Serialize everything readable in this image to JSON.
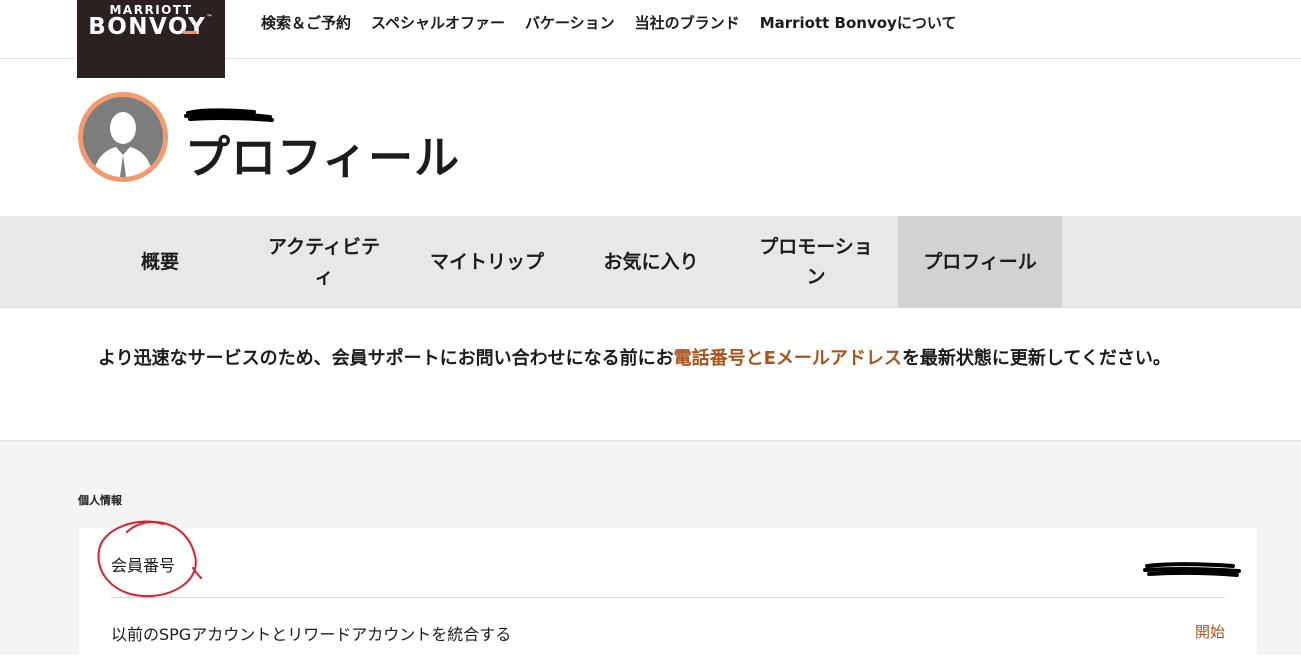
{
  "header": {
    "logo": {
      "top_text": "MARRIOTT",
      "main_text": "BONVOY",
      "trademark": "™"
    },
    "nav": [
      {
        "label": "検索＆ご予約"
      },
      {
        "label": "スペシャルオファー"
      },
      {
        "label": "バケーション"
      },
      {
        "label": "当社のブランド"
      },
      {
        "label": "Marriott Bonvoyについて"
      }
    ]
  },
  "profile": {
    "title": "プロフィール"
  },
  "tabs": [
    {
      "label": "概要"
    },
    {
      "label": "アクティビティ",
      "line1": "アクティビテ",
      "line2": "ィ"
    },
    {
      "label": "マイトリップ"
    },
    {
      "label": "お気に入り"
    },
    {
      "label": "プロモーション",
      "line1": "プロモーショ",
      "line2": "ン"
    },
    {
      "label": "プロフィール",
      "active": true
    }
  ],
  "notice": {
    "before": "より迅速なサービスのため、会員サポートにお問い合わせになる前にお",
    "link": "電話番号とEメールアドレス",
    "after": "を最新状態に更新してください。"
  },
  "personal_info": {
    "section_label": "個人情報",
    "rows": [
      {
        "label": "会員番号"
      },
      {
        "label": "以前のSPGアカウントとリワードアカウントを統合する",
        "action": "開始"
      }
    ]
  },
  "colors": {
    "logo_bg": "#2a2120",
    "accent_orange": "#a8541e",
    "avatar_ring": "#f29a70",
    "tabbar_bg": "#e8e8e8",
    "tab_active_bg": "#d2d2d2",
    "content_bg": "#f4f4f4",
    "annotation_red": "#d9222a"
  },
  "icons": {
    "avatar": "default-user-avatar-icon"
  }
}
